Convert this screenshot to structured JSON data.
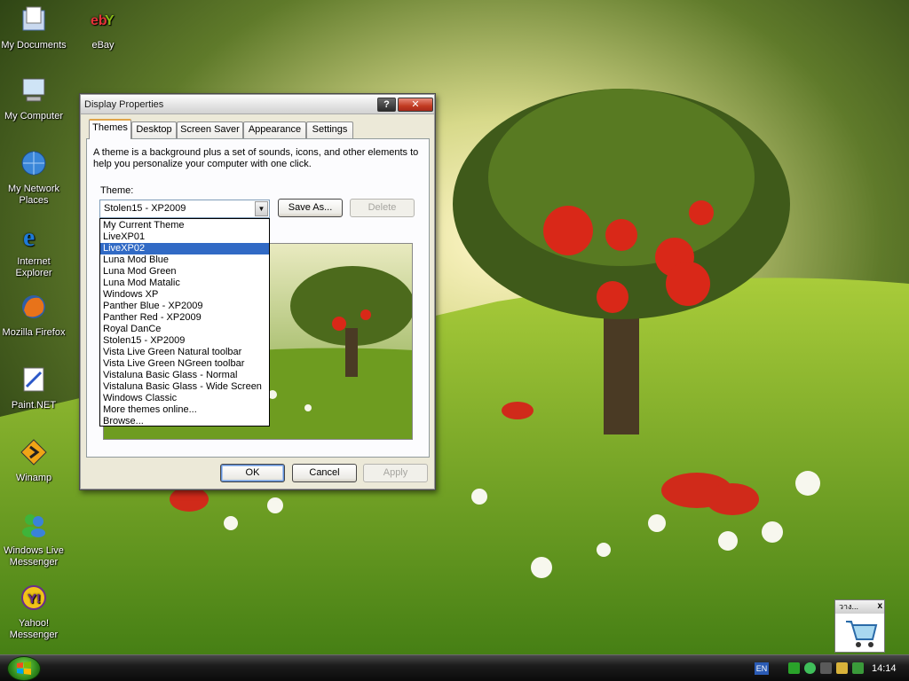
{
  "desktop": {
    "icons": [
      {
        "label": "My Documents",
        "icon": "folder-documents-icon"
      },
      {
        "label": "eBay",
        "icon": "ebay-icon"
      },
      {
        "label": "My Computer",
        "icon": "computer-icon"
      },
      {
        "label": "My Network Places",
        "icon": "network-icon"
      },
      {
        "label": "Internet Explorer",
        "icon": "internet-explorer-icon"
      },
      {
        "label": "Mozilla Firefox",
        "icon": "firefox-icon"
      },
      {
        "label": "Paint.NET",
        "icon": "paint-net-icon"
      },
      {
        "label": "Winamp",
        "icon": "winamp-icon"
      },
      {
        "label": "Windows Live Messenger",
        "icon": "messenger-icon"
      },
      {
        "label": "Yahoo! Messenger",
        "icon": "yahoo-messenger-icon"
      }
    ]
  },
  "dialog": {
    "title": "Display Properties",
    "help_label": "?",
    "close_label": "✕",
    "tabs": [
      {
        "label": "Themes",
        "active": true
      },
      {
        "label": "Desktop",
        "active": false
      },
      {
        "label": "Screen Saver",
        "active": false
      },
      {
        "label": "Appearance",
        "active": false
      },
      {
        "label": "Settings",
        "active": false
      }
    ],
    "description": "A theme is a background plus a set of sounds, icons, and other elements to help you personalize your computer with one click.",
    "theme_label": "Theme:",
    "theme_selected": "Stolen15 - XP2009",
    "save_as_label": "Save As...",
    "delete_label": "Delete",
    "ok_label": "OK",
    "cancel_label": "Cancel",
    "apply_label": "Apply"
  },
  "dropdown": {
    "selected_index": 2,
    "items": [
      "My Current Theme",
      "LiveXP01",
      "LiveXP02",
      "Luna Mod Blue",
      "Luna Mod Green",
      "Luna Mod Matalic",
      "Windows XP",
      "Panther Blue - XP2009",
      "Panther Red - XP2009",
      "Royal DanCe",
      "Stolen15 - XP2009",
      "Vista Live Green Natural toolbar",
      "Vista Live Green NGreen toolbar",
      "Vistaluna Basic Glass - Normal",
      "Vistaluna Basic Glass - Wide Screen",
      "Windows Classic",
      "More themes online...",
      "Browse..."
    ]
  },
  "widget": {
    "title": "วาง...",
    "close_label": "x"
  },
  "taskbar": {
    "language": "EN",
    "clock": "14:14"
  },
  "colors": {
    "selection": "#316ac5",
    "dialog_bg": "#ece9d8",
    "start_orb": "#2f8a1c"
  }
}
